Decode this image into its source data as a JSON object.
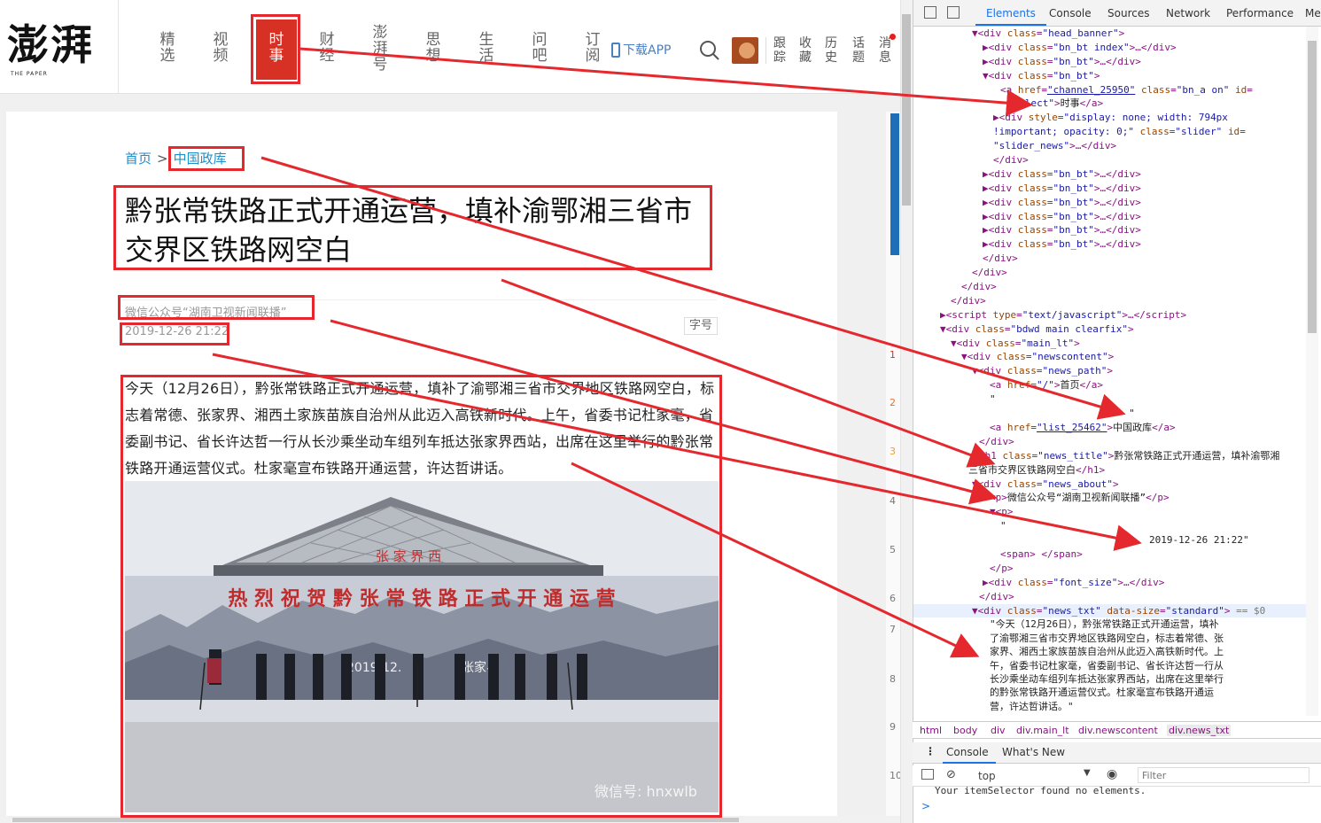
{
  "site": {
    "logo_text": "澎湃",
    "logo_sub": "THE PAPER",
    "nav": [
      "精选",
      "视频",
      "时事",
      "财经",
      "澎湃号",
      "思想",
      "生活",
      "问吧",
      "订阅"
    ],
    "active_nav": "时事",
    "download": "下载APP",
    "side": [
      "跟踪",
      "收藏",
      "历史",
      "话题",
      "消息"
    ]
  },
  "article": {
    "crumb_home": "首页",
    "crumb_sep": ">",
    "crumb_channel": "中国政库",
    "title": "黔张常铁路正式开通运营，填补渝鄂湘三省市交界区铁路网空白",
    "source": "微信公众号“湖南卫视新闻联播”",
    "date": "2019-12-26 21:22",
    "font_size_btn": "字号",
    "body": "今天（12月26日），黔张常铁路正式开通运营，填补了渝鄂湘三省市交界地区铁路网空白，标志着常德、张家界、湘西土家族苗族自治州从此迈入高铁新时代。上午，省委书记杜家毫，省委副书记、省长许达哲一行从长沙乘坐动车组列车抵达张家界西站，出席在这里举行的黔张常铁路开通运营仪式。杜家毫宣布铁路开通运营，许达哲讲话。",
    "photo_station": "张 家 界 西",
    "photo_banner": "热 烈 祝 贺 黔 张 常 铁 路 正 式 开 通 运 营",
    "photo_watermark": "微信号: hnxwlb",
    "photo_date": "2019.12.",
    "photo_place": "张家界"
  },
  "right_strip_numbers": [
    "1",
    "2",
    "3",
    "4",
    "5",
    "6",
    "7",
    "8",
    "9",
    "10"
  ],
  "devtools": {
    "tabs": [
      "Elements",
      "Console",
      "Sources",
      "Network",
      "Performance",
      "Me"
    ],
    "active_tab": "Elements",
    "breadcrumbs": [
      "html",
      "body",
      "div",
      "div.main_lt",
      "div.newscontent",
      "div.news_txt"
    ],
    "console_tabs": [
      "Console",
      "What's New"
    ],
    "console_context": "top",
    "console_filter_placeholder": "Filter",
    "console_message": "Your itemSelector found no elements.",
    "prompt": ">"
  },
  "colors": {
    "accent_red": "#d73024",
    "annotation_red": "#e5282e",
    "link_blue": "#1f8fc8",
    "devtools_blue": "#1a73e8"
  }
}
